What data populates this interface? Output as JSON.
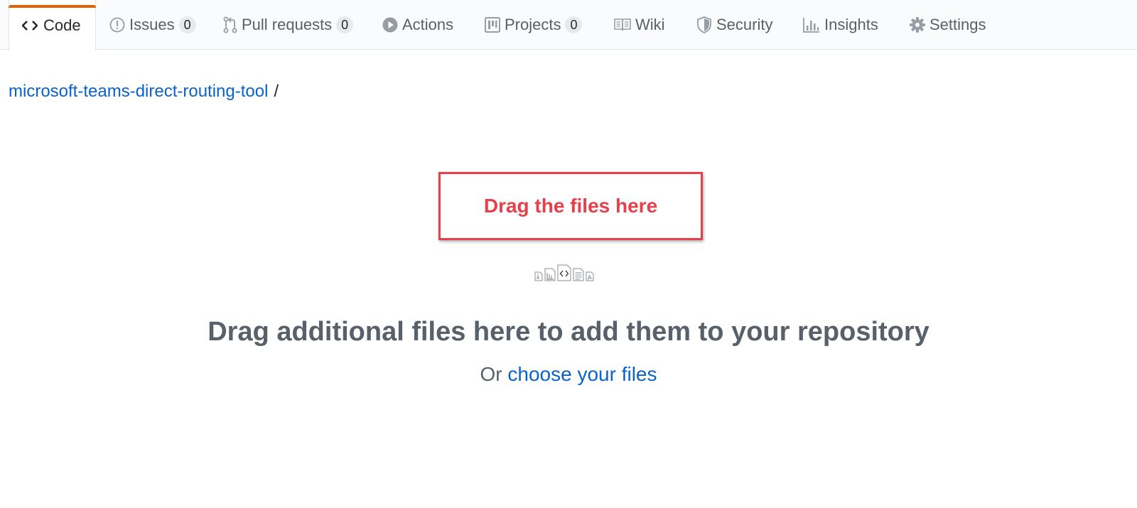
{
  "nav": {
    "tabs": [
      {
        "label": "Code",
        "icon": "code-icon"
      },
      {
        "label": "Issues",
        "icon": "issue-opened-icon",
        "count": "0"
      },
      {
        "label": "Pull requests",
        "icon": "git-pull-request-icon",
        "count": "0"
      },
      {
        "label": "Actions",
        "icon": "play-icon"
      },
      {
        "label": "Projects",
        "icon": "project-icon",
        "count": "0"
      },
      {
        "label": "Wiki",
        "icon": "book-icon"
      },
      {
        "label": "Security",
        "icon": "shield-icon"
      },
      {
        "label": "Insights",
        "icon": "graph-icon"
      },
      {
        "label": "Settings",
        "icon": "gear-icon"
      }
    ],
    "selected": "Code"
  },
  "breadcrumb": {
    "repo": "microsoft-teams-direct-routing-tool",
    "separator": "/"
  },
  "annotation": {
    "text": "Drag the files here",
    "color": "#e8404a"
  },
  "upload": {
    "file_icons": [
      "file-zip-icon",
      "file-media-icon",
      "file-code-icon",
      "file-text-icon",
      "file-pdf-icon"
    ],
    "headline": "Drag additional files here to add them to your repository",
    "or_text": "Or",
    "choose_link": "choose your files"
  },
  "colors": {
    "accent_tab": "#e36209",
    "link": "#0b63c9",
    "muted_text": "#586069"
  }
}
